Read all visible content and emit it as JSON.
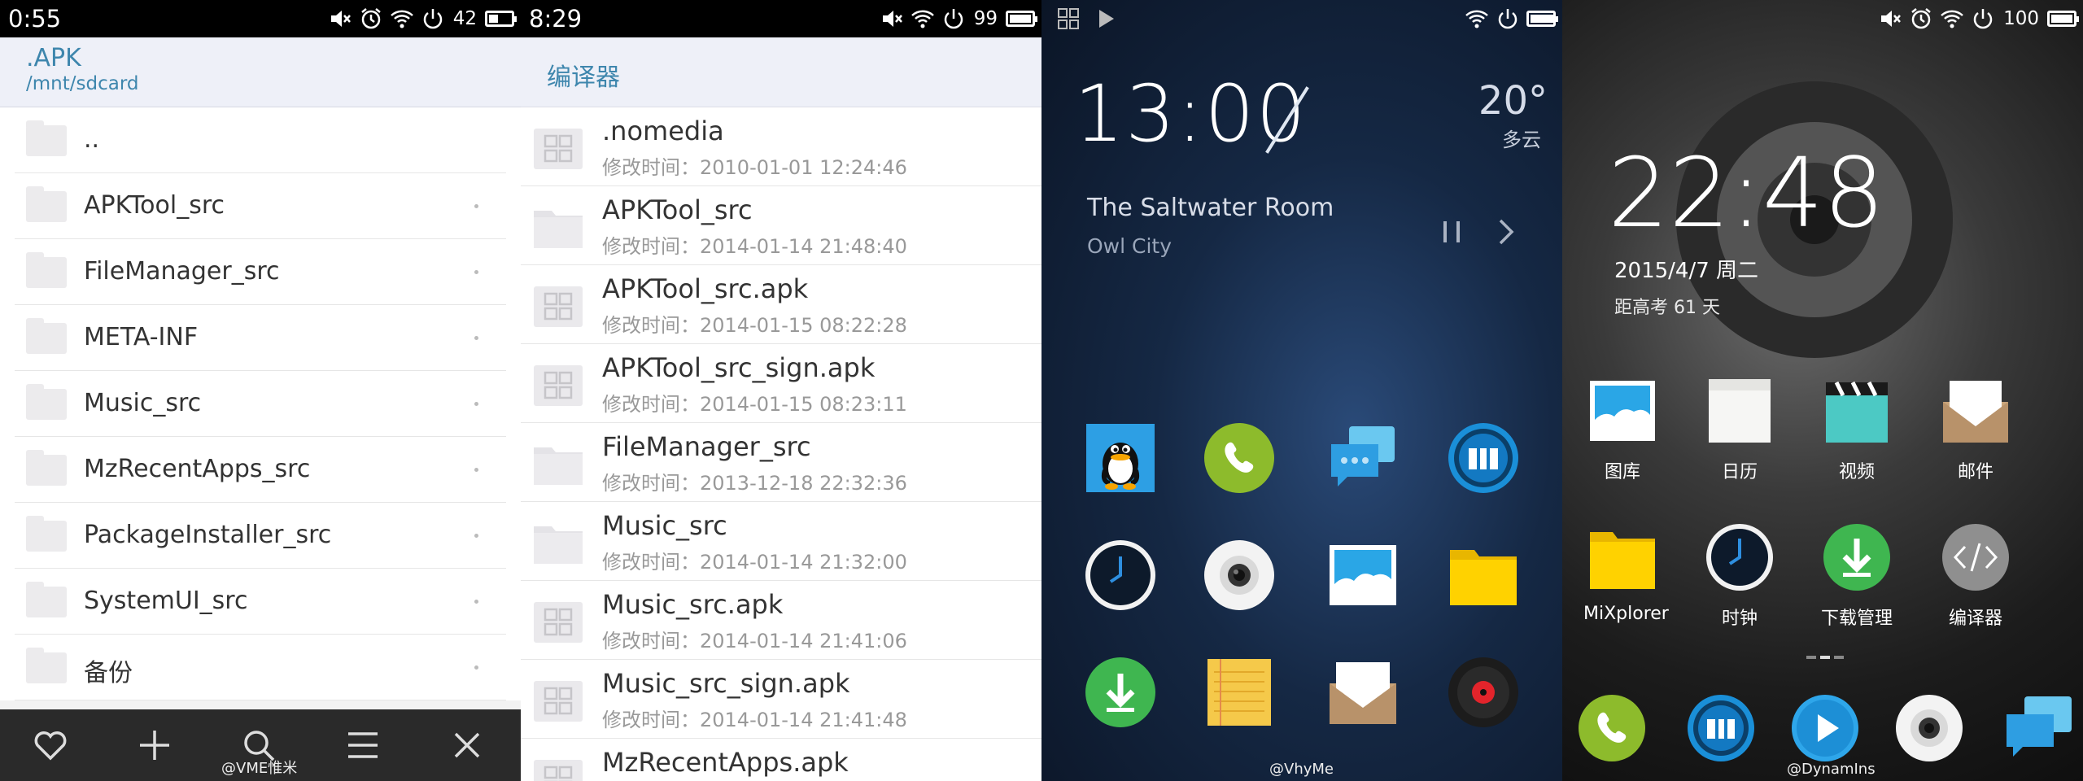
{
  "screen1": {
    "status": {
      "time": "0:55",
      "battery": "42",
      "battery_level": 0.42
    },
    "header": {
      "title": ".APK",
      "path": "/mnt/sdcard"
    },
    "items": [
      "..",
      "APKTool_src",
      "FileManager_src",
      "META-INF",
      "Music_src",
      "MzRecentApps_src",
      "PackageInstaller_src",
      "SystemUI_src",
      "备份"
    ],
    "toolbar": [
      "heart-icon",
      "plus-icon",
      "search-icon",
      "menu-icon",
      "close-icon"
    ],
    "watermark": "@VME惟米"
  },
  "screen2": {
    "status": {
      "time": "8:29",
      "battery": "99",
      "battery_level": 0.99
    },
    "header": {
      "title": "编译器"
    },
    "files": [
      {
        "name": ".nomedia",
        "date": "修改时间：2010-01-01 12:24:46",
        "type": "file"
      },
      {
        "name": "APKTool_src",
        "date": "修改时间：2014-01-14 21:48:40",
        "type": "folder"
      },
      {
        "name": "APKTool_src.apk",
        "date": "修改时间：2014-01-15 08:22:28",
        "type": "file"
      },
      {
        "name": "APKTool_src_sign.apk",
        "date": "修改时间：2014-01-15 08:23:11",
        "type": "file"
      },
      {
        "name": "FileManager_src",
        "date": "修改时间：2013-12-18 22:32:36",
        "type": "folder"
      },
      {
        "name": "Music_src",
        "date": "修改时间：2014-01-14 21:32:00",
        "type": "folder"
      },
      {
        "name": "Music_src.apk",
        "date": "修改时间：2014-01-14 21:41:06",
        "type": "file"
      },
      {
        "name": "Music_src_sign.apk",
        "date": "修改时间：2014-01-14 21:41:48",
        "type": "file"
      },
      {
        "name": "MzRecentApps.apk",
        "date": "",
        "type": "file"
      }
    ]
  },
  "screen3": {
    "clock": "13:00",
    "temperature": "20°",
    "weather": "多云",
    "song": "The Saltwater Room",
    "artist": "Owl City",
    "apps": [
      "qq-icon",
      "phone-icon",
      "messages-icon",
      "meizu-icon",
      "clock-icon",
      "camera-icon",
      "gallery-icon",
      "folder-icon",
      "download-icon",
      "notes-icon",
      "mail-icon",
      "music-icon"
    ],
    "watermark": "@VhyMe"
  },
  "screen4": {
    "status": {
      "battery": "100",
      "battery_level": 1.0
    },
    "clock": "22:48",
    "date": "2015/4/7 周二",
    "countdown": "距高考 61 天",
    "apps_row1": [
      {
        "label": "图库",
        "icon": "gallery-icon"
      },
      {
        "label": "日历",
        "icon": "calendar-icon"
      },
      {
        "label": "视频",
        "icon": "video-icon"
      },
      {
        "label": "邮件",
        "icon": "mail-icon"
      }
    ],
    "apps_row2": [
      {
        "label": "MiXplorer",
        "icon": "folder-icon"
      },
      {
        "label": "时钟",
        "icon": "clock-icon"
      },
      {
        "label": "下载管理",
        "icon": "download-icon"
      },
      {
        "label": "编译器",
        "icon": "code-icon"
      }
    ],
    "dock": [
      "phone-icon",
      "meizu-icon",
      "play-icon",
      "camera-icon",
      "messages-icon"
    ],
    "watermark": "@DynamIns"
  }
}
